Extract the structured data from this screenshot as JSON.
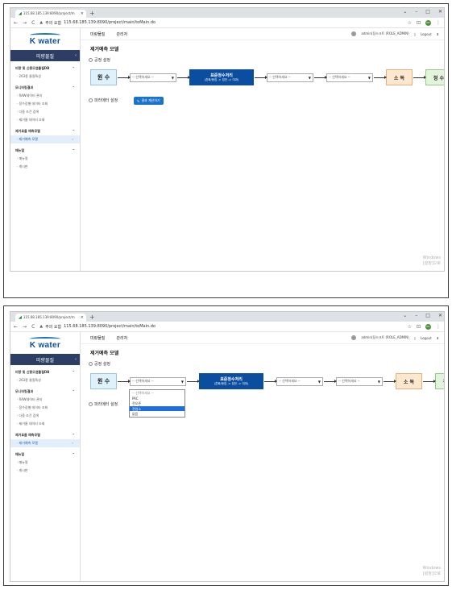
{
  "browser": {
    "tab_title": "115.68.185.139:8090/project/m",
    "new_tab_glyph": "+",
    "window_controls": [
      "⌄",
      "–",
      "□",
      "✕"
    ],
    "url_warning": "주의 요함",
    "url": "115.68.185.139:8090/project/main/toMain.do",
    "profile_initial": "NU"
  },
  "app": {
    "logo_text": "K water",
    "menu_title": "미량물질",
    "topnav": [
      "미량물질",
      "관리자"
    ],
    "user_label": "admin(장스크트 (ROLE_ADMIN)",
    "logout_label": "Logout"
  },
  "sidebar": {
    "groups": [
      {
        "title": "미량 및 신종오염물질DB",
        "items": [
          "263종 물질특성"
        ]
      },
      {
        "title": "모니터링결과",
        "items": [
          "RAW데이터 관리",
          "정수장별 데이터 조회",
          "다중 조건 검색",
          "제거율 데이터 조회"
        ]
      },
      {
        "title": "제거효율 예측모델",
        "items": [
          "제거예측 모델"
        ]
      },
      {
        "title": "매뉴얼",
        "items": [
          "매뉴얼",
          "게시판"
        ]
      }
    ]
  },
  "page": {
    "title": "제거예측 모델",
    "process_label": "공정 설정",
    "param_label": "파라메터 설정",
    "calc_button": "결과 계산하기",
    "box_raw": "원 수",
    "box_std_title": "표준정수처리",
    "box_std_sub": "(혼화/응집 -> 침전 -> 여과)",
    "box_dis": "소 독",
    "box_clean": "정 수",
    "select_placeholder": "-- 선택하세요 --"
  },
  "dropdown": {
    "options": [
      "-- 선택하세요 --",
      "PAC",
      "전오존",
      "전염소",
      "없음"
    ],
    "highlighted": "전염소"
  },
  "watermark": {
    "line1": "Windows",
    "line2": "[설정]으로"
  }
}
